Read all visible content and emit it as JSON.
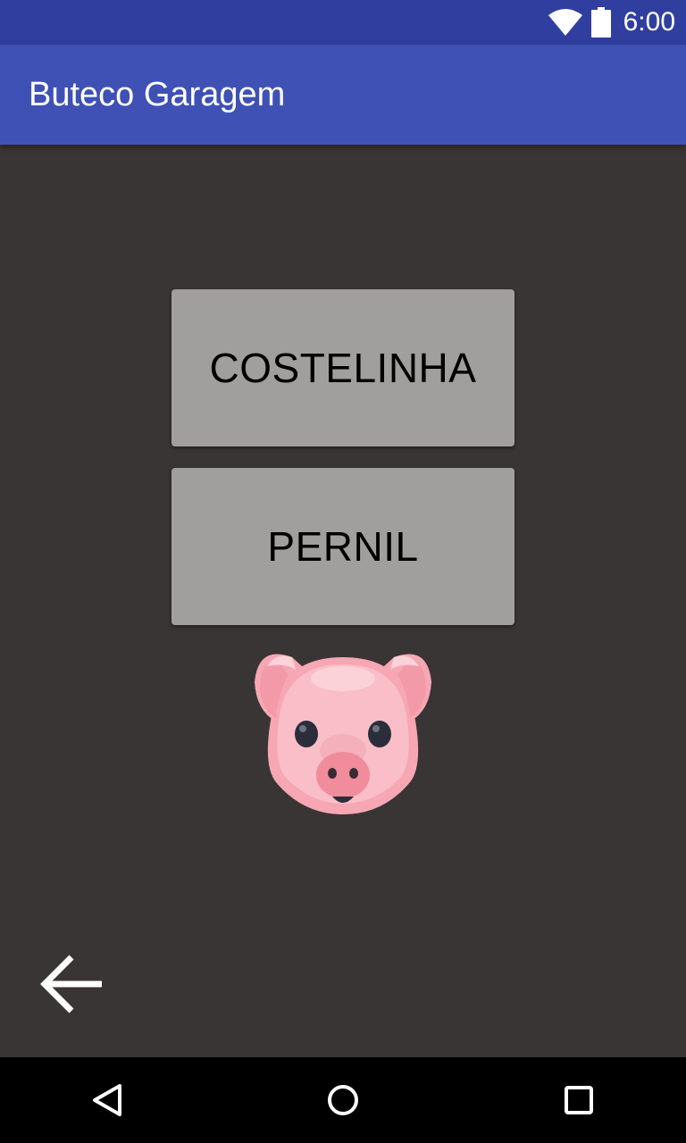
{
  "status_bar": {
    "time": "6:00",
    "icons": [
      "wifi-icon",
      "battery-icon"
    ],
    "color": "#303F9F"
  },
  "app_bar": {
    "title": "Buteco Garagem",
    "color": "#3F51B5"
  },
  "main": {
    "background": "#393534",
    "buttons": [
      {
        "label": "COSTELINHA"
      },
      {
        "label": "PERNIL"
      }
    ],
    "image_icon": "pig-face-icon",
    "back_icon": "arrow-left-icon"
  },
  "nav_bar": {
    "buttons": [
      "back-triangle-icon",
      "home-circle-icon",
      "recents-square-icon"
    ]
  }
}
